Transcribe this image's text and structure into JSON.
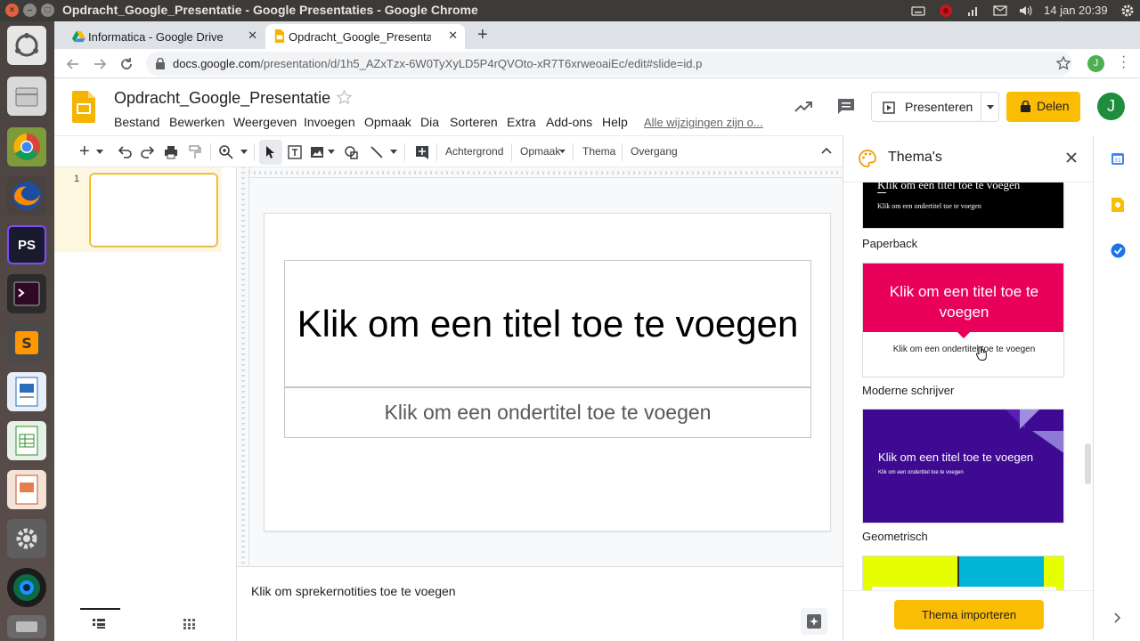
{
  "os": {
    "window_title": "Opdracht_Google_Presentatie - Google Presentaties - Google Chrome",
    "clock": "14 jan 20:39"
  },
  "launcher": {
    "items": [
      "dash-icon",
      "files-icon",
      "chrome-icon",
      "firefox-icon",
      "PS",
      "terminal-icon",
      "sublime-icon",
      "writer-icon",
      "calc-icon",
      "impress-icon",
      "settings-icon",
      "lens-icon",
      "drive-icon"
    ]
  },
  "browser": {
    "tabs": [
      {
        "title": "Informatica - Google Drive",
        "active": false
      },
      {
        "title": "Opdracht_Google_Presentatie",
        "active": true
      }
    ],
    "url_host": "docs.google.com",
    "url_path": "/presentation/d/1h5_AZxTzx-6W0TyXyLD5P4rQVOto-xR7T6xrweoaiEc/edit#slide=id.p",
    "profile_initial": "J"
  },
  "docs": {
    "title": "Opdracht_Google_Presentatie",
    "menus": [
      "Bestand",
      "Bewerken",
      "Weergeven",
      "Invoegen",
      "Opmaak",
      "Dia",
      "Sorteren",
      "Extra",
      "Add-ons",
      "Help"
    ],
    "save_status": "Alle wijzigingen zijn o...",
    "present_label": "Presenteren",
    "share_label": "Delen",
    "account_initial": "J"
  },
  "toolbar": {
    "background": "Achtergrond",
    "format": "Opmaak",
    "theme": "Thema",
    "transition": "Overgang"
  },
  "filmstrip": {
    "slide_number": "1"
  },
  "slide": {
    "title_placeholder": "Klik om een titel toe te voegen",
    "subtitle_placeholder": "Klik om een ondertitel toe te voegen"
  },
  "notes": {
    "placeholder": "Klik om sprekernotities toe te voegen"
  },
  "themes_panel": {
    "heading": "Thema's",
    "themes": [
      {
        "name": "Paperback",
        "preview_title": "Klik om een titel toe te voegen",
        "preview_subtitle": "Klik om een ondertitel toe te voegen"
      },
      {
        "name": "Moderne schrijver",
        "preview_title": "Klik om een titel toe te voegen",
        "preview_subtitle": "Klik om een ondertitel toe te voegen"
      },
      {
        "name": "Geometrisch",
        "preview_title": "Klik om een titel toe te voegen",
        "preview_subtitle": "Klik om een ondertitel toe te voegen"
      }
    ],
    "import_button": "Thema importeren"
  },
  "colors": {
    "accent_yellow": "#fbbc04",
    "docs_yellow": "#f4b400",
    "modern_pink": "#e8005a",
    "geometric_purple": "#3d0a91",
    "profile_green": "#1e8e3e"
  }
}
